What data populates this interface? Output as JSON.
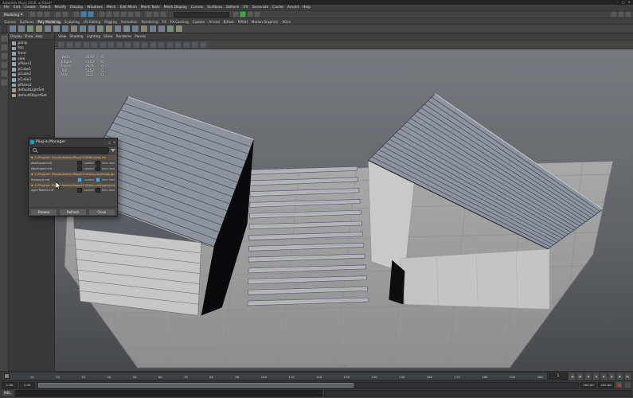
{
  "window": {
    "title": "Autodesk Maya 2018: untitled*",
    "controls": [
      "minimize",
      "maximize",
      "close"
    ]
  },
  "menu_bar": [
    "File",
    "Edit",
    "Create",
    "Select",
    "Modify",
    "Display",
    "Windows",
    "Mesh",
    "Edit Mesh",
    "Mesh Tools",
    "Mesh Display",
    "Curves",
    "Surfaces",
    "Deform",
    "UV",
    "Generate",
    "Cache",
    "Arnold",
    "Help"
  ],
  "status_line": {
    "menu_set": "Modeling",
    "groups": [
      {
        "name": "scene-file",
        "icons": [
          "new-scene-icon",
          "open-scene-icon",
          "save-scene-icon"
        ]
      },
      {
        "name": "undo-redo",
        "icons": [
          "undo-icon",
          "redo-icon"
        ]
      },
      {
        "name": "selection-masks",
        "icons": [
          "select-hierarchy-icon",
          "select-object-icon",
          "select-component-icon"
        ],
        "active_indices": [
          1,
          2
        ]
      },
      {
        "name": "snapping",
        "icons": [
          "snap-grid-icon",
          "snap-curve-icon",
          "snap-point-icon",
          "snap-projected-center-icon",
          "snap-view-plane-icon",
          "make-live-icon"
        ]
      },
      {
        "name": "history",
        "icons": [
          "construction-history-icon",
          "input-connections-icon",
          "output-connections-icon"
        ]
      },
      {
        "name": "render",
        "icons": [
          "open-render-view-icon",
          "render-current-frame-icon",
          "ipr-render-icon",
          "render-settings-icon"
        ],
        "green_index": 1
      },
      {
        "name": "sidebar-toggles",
        "icons": [
          "attribute-editor-toggle-icon",
          "tool-settings-toggle-icon",
          "channel-box-toggle-icon"
        ]
      }
    ]
  },
  "shelf": {
    "tabs": [
      "Curves",
      "Surfaces",
      "Poly Modeling",
      "Sculpting",
      "UV Editing",
      "Rigging",
      "Animation",
      "Rendering",
      "FX",
      "FX Caching",
      "Custom",
      "Arnold",
      "Bifrost",
      "MASH",
      "Motion Graphics",
      "XGen"
    ],
    "active_tab": "Poly Modeling",
    "items": [
      "sphere",
      "cube",
      "cylinder",
      "cone",
      "torus",
      "plane",
      "disc",
      "platonic",
      "pyramid",
      "prism",
      "pipe",
      "helix",
      "gear",
      "soccer-ball",
      "type",
      "svg",
      "boolean-union",
      "boolean-difference",
      "combine",
      "separate"
    ]
  },
  "toolbox": [
    "select-tool",
    "lasso-tool",
    "paint-select-tool",
    "move-tool",
    "rotate-tool",
    "scale-tool"
  ],
  "outliner": {
    "menus": [
      "Display",
      "Show",
      "Help"
    ],
    "items": [
      {
        "label": "persp",
        "icon": "camera-icon"
      },
      {
        "label": "top",
        "icon": "camera-icon"
      },
      {
        "label": "front",
        "icon": "camera-icon"
      },
      {
        "label": "side",
        "icon": "camera-icon"
      },
      {
        "label": "pPlane1",
        "icon": "mesh-icon"
      },
      {
        "label": "pCube1",
        "icon": "mesh-icon"
      },
      {
        "label": "pCube2",
        "icon": "mesh-icon"
      },
      {
        "label": "pCube3",
        "icon": "mesh-icon"
      },
      {
        "label": "pPlane2",
        "icon": "mesh-icon"
      },
      {
        "label": "defaultLightSet",
        "icon": "set-icon"
      },
      {
        "label": "defaultObjectSet",
        "icon": "set-icon"
      }
    ]
  },
  "viewport": {
    "panel_menus": [
      "View",
      "Shading",
      "Lighting",
      "Show",
      "Renderer",
      "Panels"
    ],
    "camera_label": "persp",
    "hud": {
      "rows": [
        {
          "name": "Verts",
          "total": "2678",
          "selected": "0"
        },
        {
          "name": "Edges",
          "total": "5353",
          "selected": "0"
        },
        {
          "name": "Faces",
          "total": "2676",
          "selected": "0"
        },
        {
          "name": "Tris",
          "total": "5352",
          "selected": "0"
        },
        {
          "name": "UVs",
          "total": "3122",
          "selected": "0"
        }
      ]
    }
  },
  "plugin_manager": {
    "title": "Plug-in Manager",
    "search_placeholder": "",
    "loaded_label": "Loaded",
    "auto_load_label": "Auto load",
    "sections": [
      {
        "path": "C:/Program Files/Autodesk/Maya2018/bin/plug-ins",
        "plugins": [
          {
            "name": "AbcExport.mll",
            "loaded": false,
            "auto": false
          },
          {
            "name": "AbcImport.mll",
            "loaded": false,
            "auto": false
          }
        ]
      },
      {
        "path": "C:/Program Files/Autodesk/Maya2018/plug-ins/fbx/plug-ins",
        "plugins": [
          {
            "name": "fbxmaya.mll",
            "loaded": true,
            "auto": true
          }
        ]
      },
      {
        "path": "C:/Program Files/Autodesk/Maya2018/plug-ins/xgen/plug-ins",
        "plugins": [
          {
            "name": "xgenToolkit.mll",
            "loaded": false,
            "auto": false
          }
        ]
      }
    ],
    "buttons": [
      "Browse",
      "Refresh",
      "Close"
    ]
  },
  "timeline": {
    "current": "1",
    "labels": [
      "1",
      "10",
      "20",
      "30",
      "40",
      "50",
      "60",
      "70",
      "80",
      "90",
      "100",
      "110",
      "120",
      "130",
      "140",
      "150",
      "160",
      "170",
      "180",
      "190",
      "200"
    ],
    "playback_icons": [
      "go-to-start-icon",
      "step-back-frame-icon",
      "step-back-key-icon",
      "play-backwards-icon",
      "play-forwards-icon",
      "step-forward-key-icon",
      "step-forward-frame-icon",
      "go-to-end-icon"
    ]
  },
  "range_slider": {
    "animation_start": "1.00",
    "playback_start": "1.00",
    "playback_end": "200.00",
    "animation_end": "200.00",
    "icons": [
      "auto-keyframe-icon",
      "animation-preferences-icon"
    ]
  },
  "command_line": {
    "mode_label": "MEL",
    "input_value": "",
    "result_value": ""
  },
  "help_line": {
    "text": ""
  },
  "colors": {
    "accent_blue": "#4f7da0",
    "active_green": "#45a349",
    "autokey_red": "#b23b3b",
    "viewport_top": "#77797e",
    "viewport_bottom": "#47484b",
    "ground": "#a5a5a5",
    "mesh_light": "#c7c7c7",
    "roof_gray": "#8f949c",
    "wire_dark": "#42465a"
  }
}
